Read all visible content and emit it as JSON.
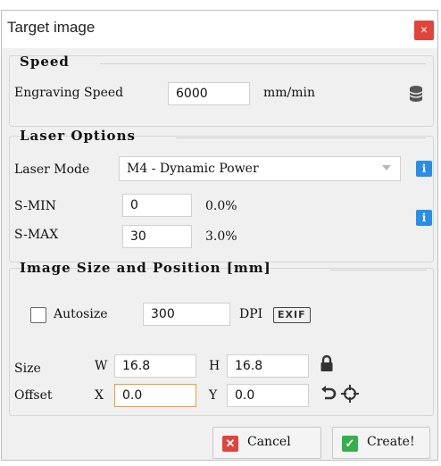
{
  "window": {
    "title": "Target image",
    "close_glyph": "×"
  },
  "speed": {
    "section_title": "Speed",
    "label": "Engraving Speed",
    "value": "6000",
    "unit": "mm/min",
    "icon": "database-icon"
  },
  "laser_options": {
    "section_title": "Laser Options",
    "mode_label": "Laser Mode",
    "mode_value": "M4 - Dynamic Power",
    "info_glyph": "i",
    "smin_label": "S-MIN",
    "smin_value": "0",
    "smin_percent": "0.0%",
    "smax_label": "S-MAX",
    "smax_value": "30",
    "smax_percent": "3.0%"
  },
  "image_size": {
    "section_title": "Image Size and Position [mm]",
    "autosize_label": "Autosize",
    "autosize_checked": false,
    "dpi_value": "300",
    "dpi_label": "DPI",
    "exif_label": "EXIF",
    "size_label": "Size",
    "w_label": "W",
    "w_value": "16.8",
    "h_label": "H",
    "h_value": "16.8",
    "offset_label": "Offset",
    "x_label": "X",
    "x_value": "0.0",
    "y_label": "Y",
    "y_value": "0.0"
  },
  "buttons": {
    "cancel_label": "Cancel",
    "create_label": "Create!"
  },
  "colors": {
    "accent_red": "#e0443a",
    "accent_green": "#35b04a",
    "info_blue": "#2b8ee6",
    "focus_orange": "#e8a23a"
  }
}
